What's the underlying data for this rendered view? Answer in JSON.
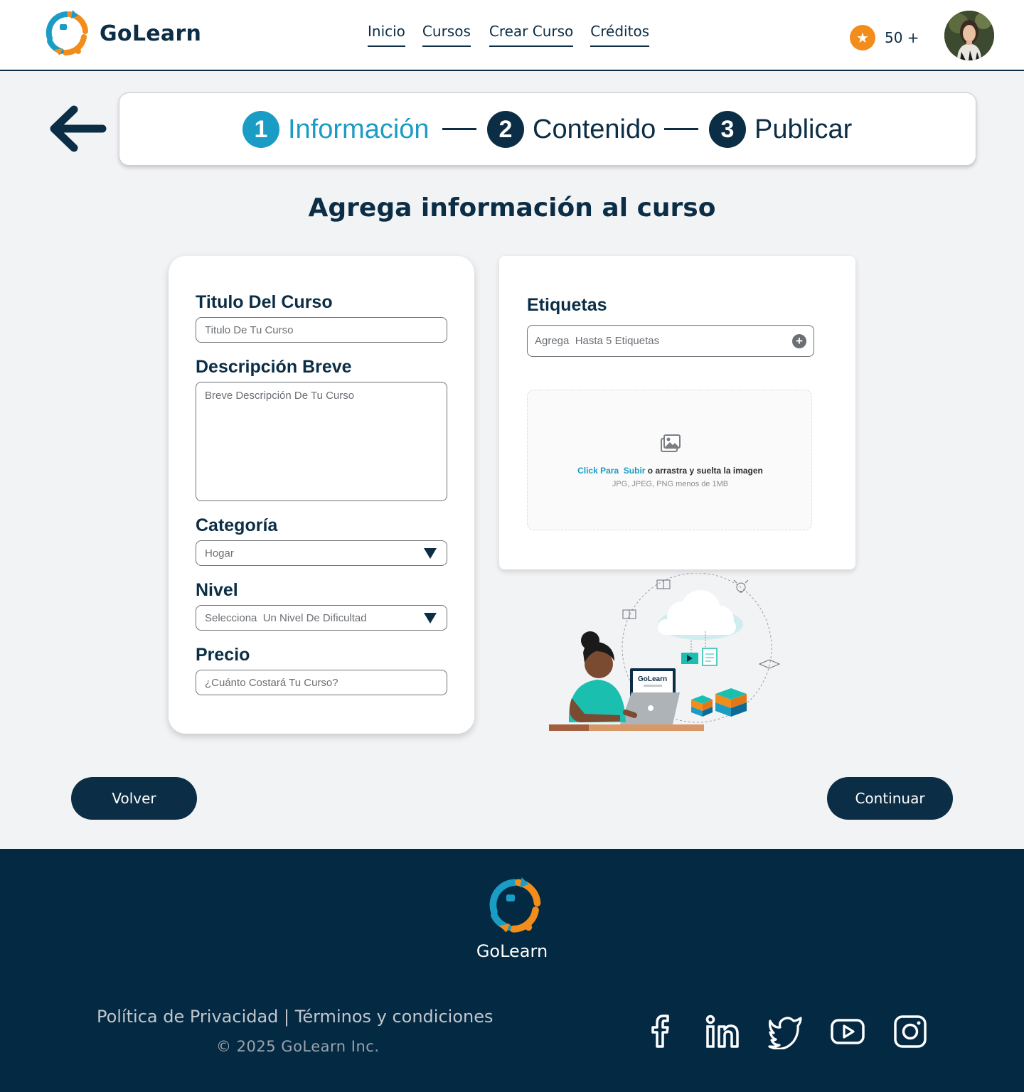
{
  "brand": {
    "name": "GoLearn"
  },
  "nav": {
    "items": [
      "Inicio",
      "Cursos",
      "Crear Curso",
      "Créditos"
    ]
  },
  "credits": {
    "count": "50 +",
    "icon": "star-icon",
    "badge_color": "#f28c1b"
  },
  "stepper": {
    "steps": [
      {
        "num": "1",
        "label": "Información",
        "active": true
      },
      {
        "num": "2",
        "label": "Contenido",
        "active": false
      },
      {
        "num": "3",
        "label": "Publicar",
        "active": false
      }
    ],
    "active_color": "#1b9cc4",
    "color": "#0b2d45"
  },
  "page": {
    "title": "Agrega información al curso"
  },
  "form": {
    "title_label": "Titulo Del Curso",
    "title_placeholder": "Titulo De Tu Curso",
    "desc_label": "Descripción Breve",
    "desc_placeholder": "Breve Descripción De Tu Curso",
    "category_label": "Categoría",
    "category_value": "Hogar",
    "level_label": "Nivel",
    "level_value": "Selecciona  Un Nivel De Dificultad",
    "price_label": "Precio",
    "price_placeholder": "¿Cuánto Costará Tu Curso?"
  },
  "tags": {
    "label": "Etiquetas",
    "placeholder": "Agrega  Hasta 5 Etiquetas"
  },
  "upload": {
    "link_text": "Click Para  Subir",
    "text": " o arrastra y suelta la imagen",
    "hint": "JPG, JPEG, PNG menos de 1MB"
  },
  "illustration": {
    "laptop_brand": "GoLearn"
  },
  "buttons": {
    "back": "Volver",
    "continue": "Continuar"
  },
  "footer": {
    "brand": "GoLearn",
    "privacy": "Política de Privacidad",
    "separator": " | ",
    "terms": "Términos y condiciones",
    "copyright": "© 2025 GoLearn Inc.",
    "social": [
      "facebook-icon",
      "linkedin-icon",
      "twitter-icon",
      "youtube-icon",
      "instagram-icon"
    ]
  },
  "colors": {
    "primary": "#0b2d45",
    "accent": "#1b9cc4",
    "orange": "#f28c1b",
    "background": "#f2f3f5"
  }
}
